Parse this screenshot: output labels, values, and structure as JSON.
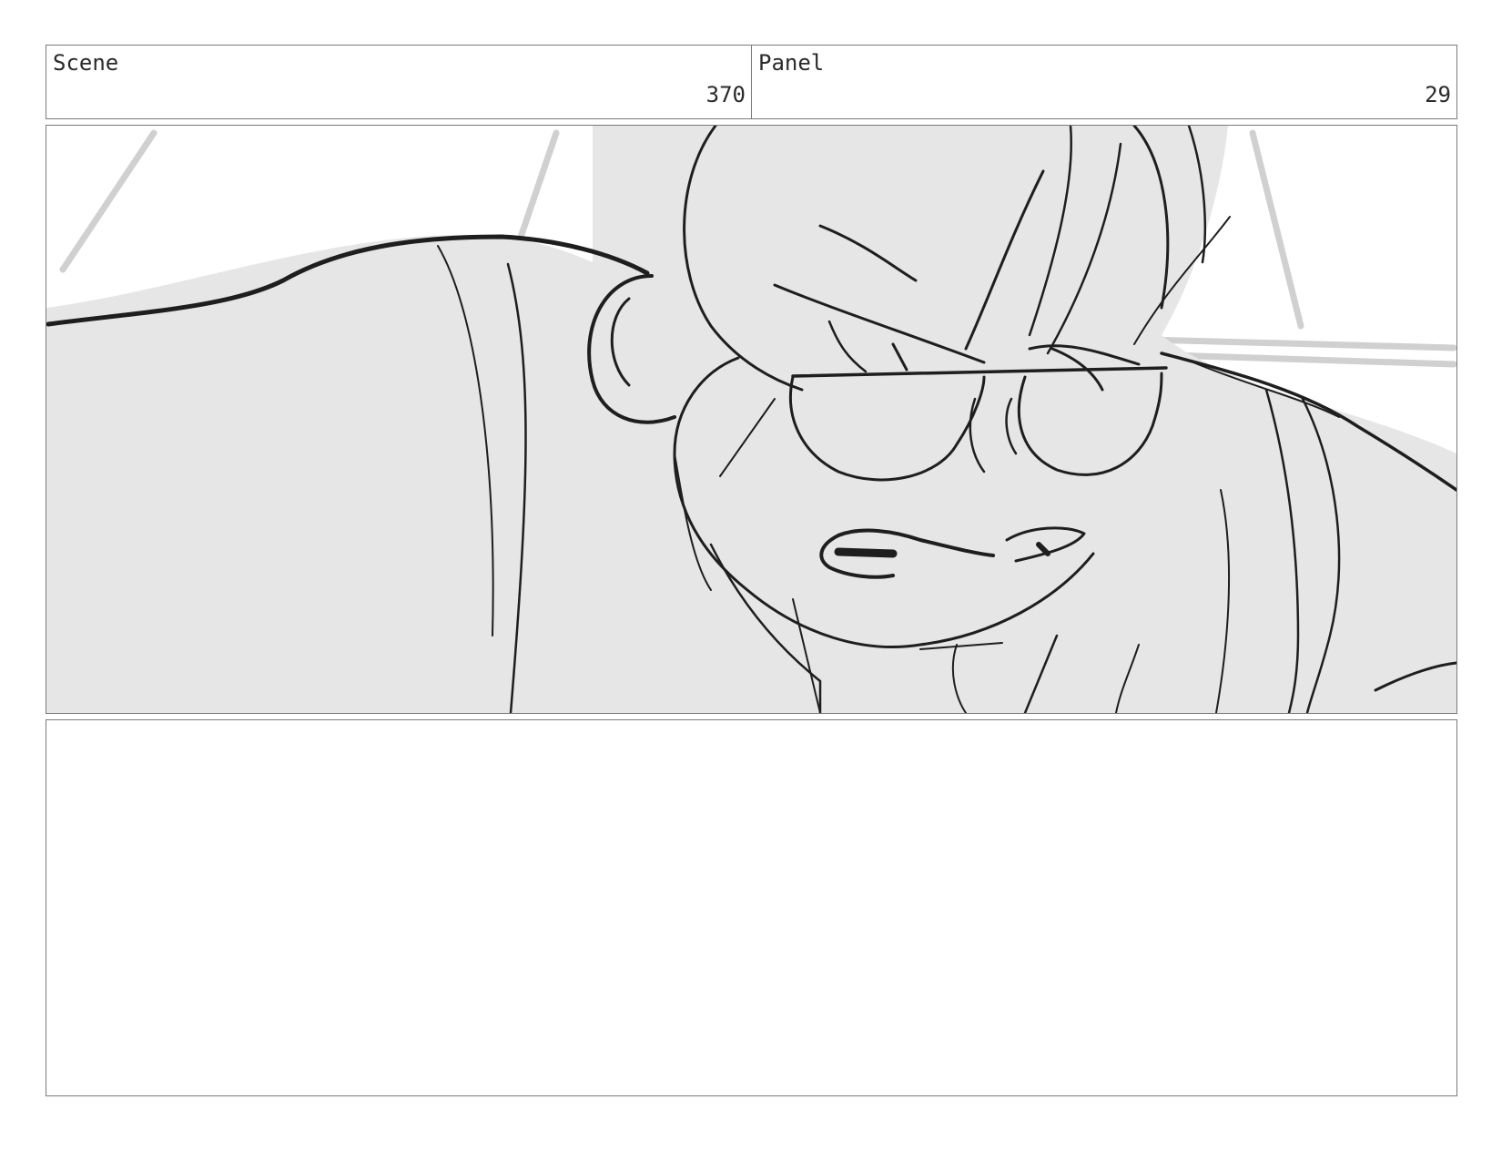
{
  "header": {
    "scene_label": "Scene",
    "scene_value": "370",
    "panel_label": "Panel",
    "panel_value": "29"
  },
  "drawing": {
    "subject": "pencil sketch of a scowling character leaning toward the camera",
    "fill_color": "#e6e6e6",
    "line_color": "#1e1e1e"
  },
  "notes": {
    "text": ""
  }
}
